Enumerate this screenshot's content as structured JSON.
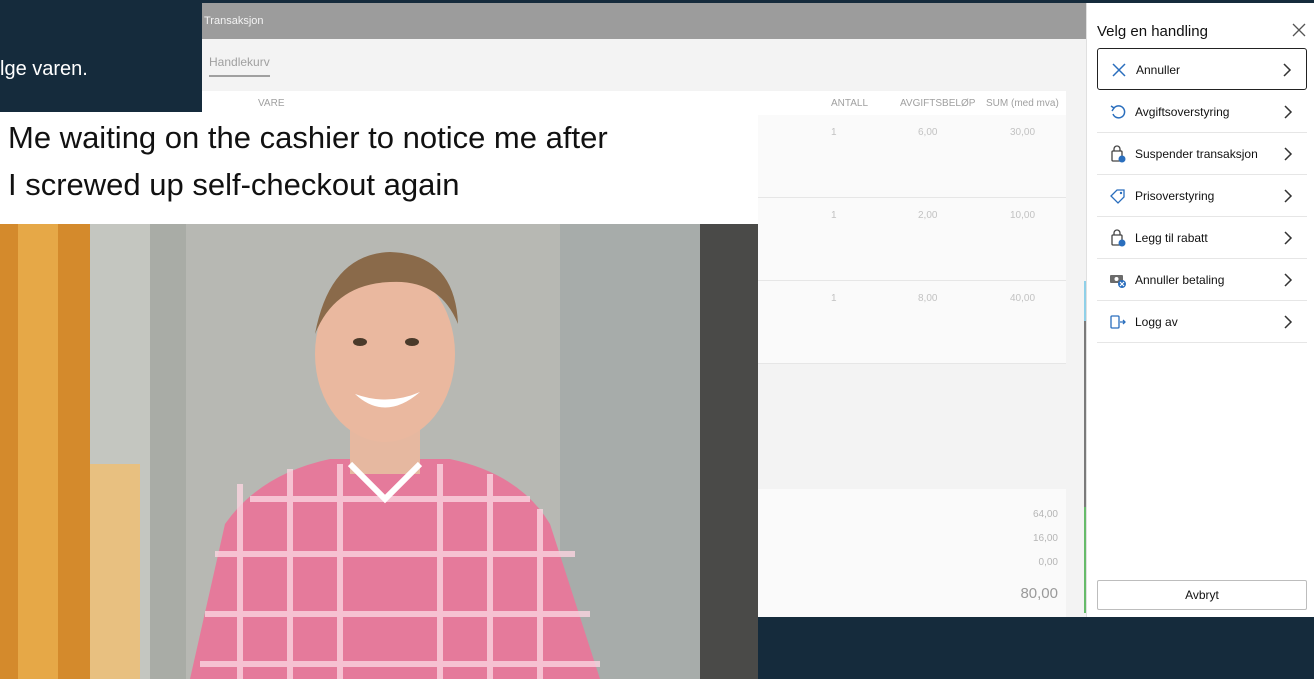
{
  "background_text": "lge varen.",
  "pos": {
    "window_title": "Transaksjon",
    "tab": "Handlekurv",
    "columns": {
      "item": "VARE",
      "qty": "ANTALL",
      "tax": "AVGIFTSBELØP",
      "sum": "SUM (med mva)"
    },
    "rows": [
      {
        "qty": "1",
        "tax": "6,00",
        "sum": "30,00"
      },
      {
        "qty": "1",
        "tax": "2,00",
        "sum": "10,00"
      },
      {
        "qty": "1",
        "tax": "8,00",
        "sum": "40,00"
      }
    ],
    "totals": {
      "subtotal": "64,00",
      "tax": "16,00",
      "discount": "0,00",
      "total": "80,00"
    }
  },
  "meme": {
    "line1": "Me waiting on the cashier to notice me after",
    "line2": "I screwed up self-checkout again"
  },
  "panel": {
    "title": "Velg en handling",
    "items": [
      {
        "label": "Annuller",
        "icon": "close-icon"
      },
      {
        "label": "Avgiftsoverstyring",
        "icon": "undo-icon"
      },
      {
        "label": "Suspender transaksjon",
        "icon": "bag-icon"
      },
      {
        "label": "Prisoverstyring",
        "icon": "price-tag-icon"
      },
      {
        "label": "Legg til rabatt",
        "icon": "bag-icon"
      },
      {
        "label": "Annuller betaling",
        "icon": "cash-cancel-icon"
      },
      {
        "label": "Logg av",
        "icon": "sign-out-icon"
      }
    ],
    "cancel_label": "Avbryt"
  },
  "colors": {
    "background": "#152b3c",
    "titlebar": "#9c9c9c",
    "accent_blue": "#8fd0e8",
    "accent_green": "#66bb6a"
  }
}
